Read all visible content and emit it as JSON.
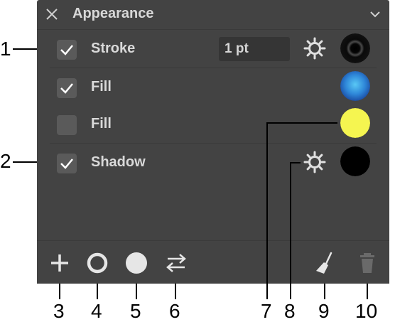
{
  "panel": {
    "title": "Appearance",
    "rows": [
      {
        "label": "Stroke",
        "checked": true,
        "width_value": "1 pt",
        "swatch_color": "#111111"
      },
      {
        "label": "Fill",
        "checked": true,
        "swatch_color": "#3a8de0"
      },
      {
        "label": "Fill",
        "checked": false,
        "swatch_color": "#f5f550"
      },
      {
        "label": "Shadow",
        "checked": true,
        "swatch_color": "#000000"
      }
    ]
  },
  "footer_tools": [
    "add-icon",
    "stroke-circle-icon",
    "fill-circle-icon",
    "swap-arrows-icon",
    "broom-icon",
    "trash-icon"
  ],
  "callouts": [
    "1",
    "2",
    "3",
    "4",
    "5",
    "6",
    "7",
    "8",
    "9",
    "10"
  ]
}
